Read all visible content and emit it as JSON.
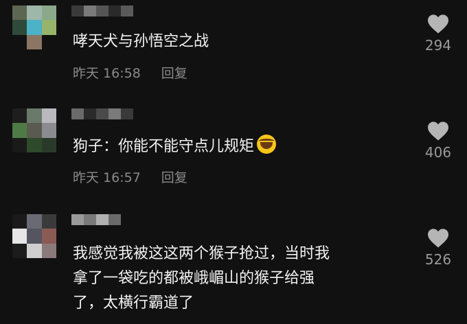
{
  "colors": {
    "background": "#111111",
    "text": "#f2f2f2",
    "meta": "#8a8a8a",
    "heart": "#b5b5b5"
  },
  "comments": [
    {
      "text": "哮天犬与孙悟空之战",
      "time": "昨天 16:58",
      "reply": "回复",
      "likes": "294"
    },
    {
      "text": "狗子：你能不能守点儿规矩",
      "emoji": "face-with-tears-of-joy-icon",
      "time": "昨天 16:57",
      "reply": "回复",
      "likes": "406"
    },
    {
      "text_lines": [
        "我感觉我被这这两个猴子抢过，当时我",
        "拿了一袋吃的都被峨嵋山的猴子给强",
        "了，太横行霸道了"
      ],
      "likes": "526"
    }
  ]
}
